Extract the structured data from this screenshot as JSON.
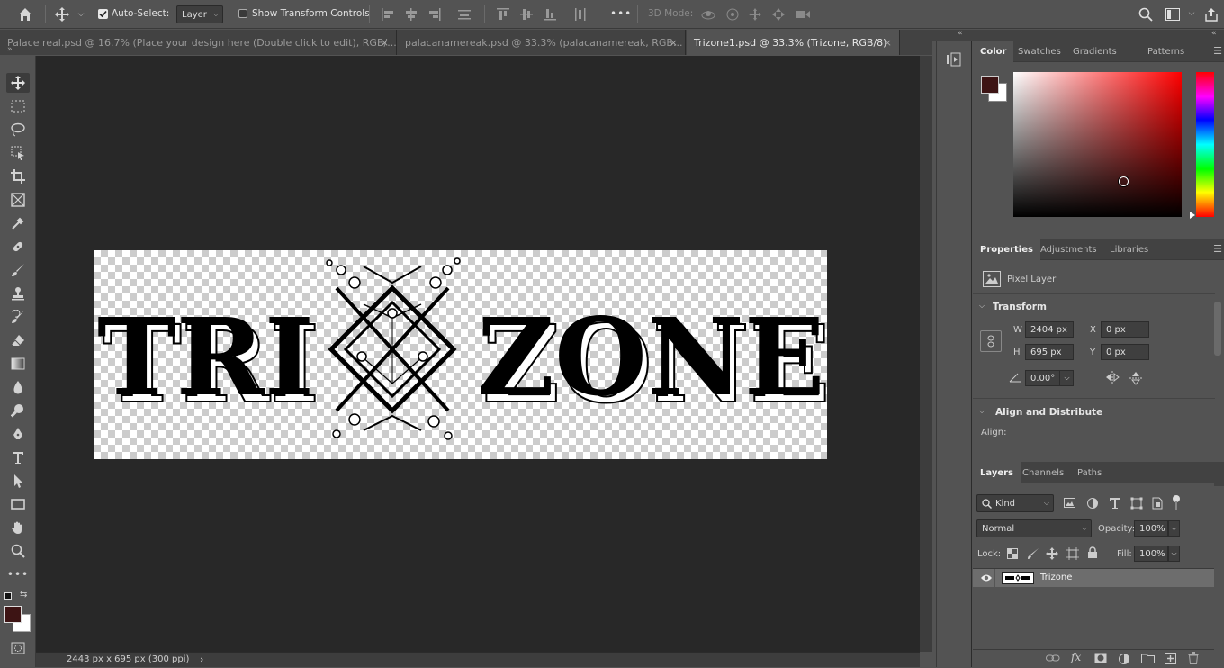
{
  "options_bar": {
    "auto_select_label": "Auto-Select:",
    "auto_select_checked": true,
    "layer_dropdown": "Layer",
    "show_transform_label": "Show Transform Controls",
    "mode_3d_label": "3D Mode:",
    "more": "•••"
  },
  "tabs": [
    {
      "label": "Palace real.psd @ 16.7% (Place your design here (Double click to edit), RGB/...",
      "close": "×"
    },
    {
      "label": "palacanamereak.psd @ 33.3% (palacanamereak, RGB...",
      "close": "×"
    },
    {
      "label": "Trizone1.psd @ 33.3% (Trizone, RGB/8)",
      "close": "×"
    }
  ],
  "toolbar": {
    "collapse": "»",
    "tools": [
      "move-tool",
      "marquee-tool",
      "lasso-tool",
      "object-select-tool",
      "crop-tool",
      "frame-tool",
      "eyedropper-tool",
      "healing-brush-tool",
      "brush-tool",
      "clone-stamp-tool",
      "history-brush-tool",
      "eraser-tool",
      "gradient-tool",
      "blur-tool",
      "dodge-tool",
      "pen-tool",
      "type-tool",
      "path-select-tool",
      "rectangle-tool",
      "hand-tool",
      "zoom-tool",
      "more-tools"
    ],
    "foreground_color": "#3d1414",
    "background_color": "#ffffff"
  },
  "document": {
    "logo_left": "TRI",
    "logo_right": "ZONE"
  },
  "status_bar": {
    "dimensions": "2443 px x 695 px (300 ppi)",
    "arrow": "›"
  },
  "color_panel": {
    "tabs": [
      "Color",
      "Swatches",
      "Gradients",
      "Patterns"
    ],
    "active_tab": "Color",
    "hue_color": "#ff0000",
    "fg": "#3d1414",
    "bg": "#ffffff"
  },
  "properties_panel": {
    "tabs": [
      "Properties",
      "Adjustments",
      "Libraries"
    ],
    "layer_type": "Pixel Layer",
    "transform_header": "Transform",
    "w_label": "W",
    "w_value": "2404 px",
    "h_label": "H",
    "h_value": "695 px",
    "x_label": "X",
    "x_value": "0 px",
    "y_label": "Y",
    "y_value": "0 px",
    "angle_value": "0.00°",
    "align_header": "Align and Distribute",
    "align_label": "Align:"
  },
  "layers_panel": {
    "tabs": [
      "Layers",
      "Channels",
      "Paths"
    ],
    "kind_label": "Kind",
    "blend_mode": "Normal",
    "opacity_label": "Opacity:",
    "opacity_value": "100%",
    "lock_label": "Lock:",
    "fill_label": "Fill:",
    "fill_value": "100%",
    "layers": [
      {
        "name": "Trizone",
        "visible": true,
        "selected": true
      }
    ],
    "bottom_icons": [
      "link-icon",
      "fx-icon",
      "mask-icon",
      "adjustment-icon",
      "group-icon",
      "new-layer-icon",
      "trash-icon"
    ],
    "fx_text": "fx"
  }
}
